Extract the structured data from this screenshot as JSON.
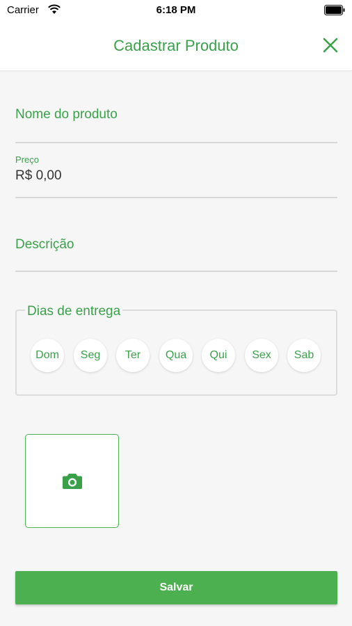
{
  "status_bar": {
    "carrier": "Carrier",
    "time": "6:18 PM"
  },
  "header": {
    "title": "Cadastrar Produto",
    "close_icon": "close-icon"
  },
  "form": {
    "name_placeholder": "Nome do produto",
    "price_label": "Preço",
    "price_value": "R$ 0,00",
    "description_placeholder": "Descrição"
  },
  "delivery": {
    "legend": "Dias de entrega",
    "days": [
      "Dom",
      "Seg",
      "Ter",
      "Qua",
      "Qui",
      "Sex",
      "Sab"
    ]
  },
  "photo": {
    "icon": "camera-icon"
  },
  "save_label": "Salvar",
  "colors": {
    "accent": "#4caf50",
    "text_green": "#3aa14a"
  }
}
